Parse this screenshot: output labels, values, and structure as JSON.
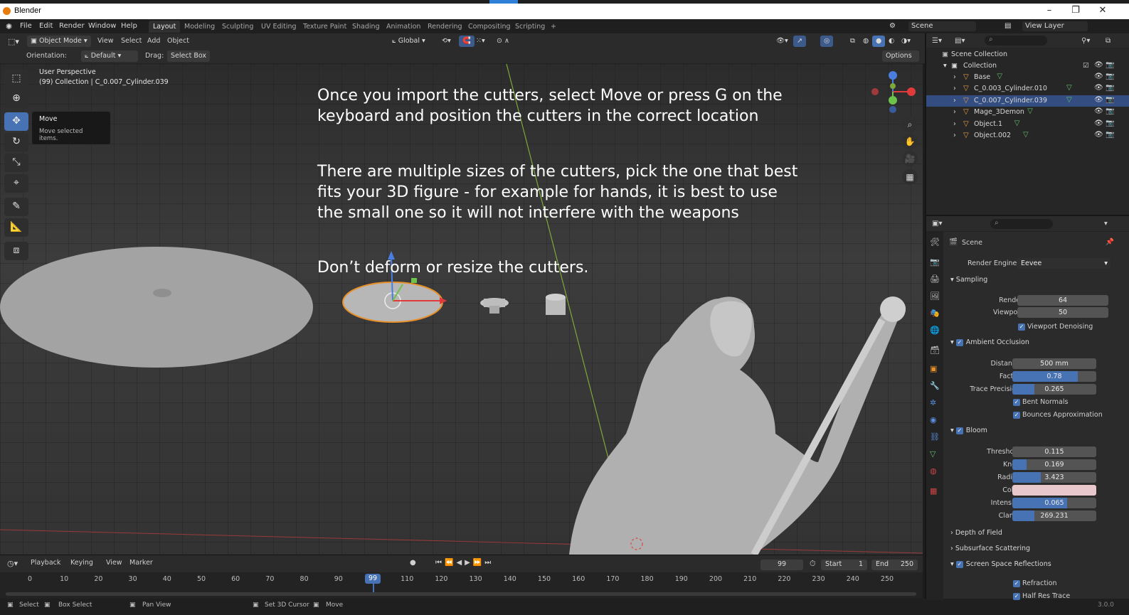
{
  "window": {
    "title": "Blender",
    "controls": [
      "–",
      "❐",
      "✕"
    ]
  },
  "menu": {
    "items": [
      "File",
      "Edit",
      "Render",
      "Window",
      "Help"
    ],
    "workspaces": [
      "Layout",
      "Modeling",
      "Sculpting",
      "UV Editing",
      "Texture Paint",
      "Shading",
      "Animation",
      "Rendering",
      "Compositing",
      "Scripting",
      "+"
    ],
    "scene": "Scene",
    "view_layer": "View Layer"
  },
  "viewport_header": {
    "mode": "Object Mode",
    "menus": [
      "View",
      "Select",
      "Add",
      "Object"
    ],
    "transform_orientation": "Global",
    "orientation_label": "Orientation:",
    "orientation_value": "Default",
    "drag_label": "Drag:",
    "drag_value": "Select Box",
    "options": "Options"
  },
  "viewport": {
    "perspective": "User Perspective",
    "collection_info": "(99) Collection | C_0.007_Cylinder.039",
    "tooltip_title": "Move",
    "tooltip_desc": "Move selected items.",
    "instructions": [
      "Once you import the cutters, select Move or press G on the\nkeyboard and position the cutters in the correct location",
      "There are multiple sizes of the cutters, pick the one that best\nfits your 3D figure - for example for hands, it is best to use\nthe small one so it will not interfere with the weapons",
      "Don’t deform or resize the cutters."
    ]
  },
  "timeline": {
    "menus": [
      "Playback",
      "Keying",
      "View",
      "Marker"
    ],
    "current_frame": "99",
    "start_label": "Start",
    "start": "1",
    "end_label": "End",
    "end": "250",
    "ruler": [
      "0",
      "10",
      "20",
      "30",
      "40",
      "50",
      "60",
      "70",
      "80",
      "90",
      "99",
      "110",
      "120",
      "130",
      "140",
      "150",
      "160",
      "170",
      "180",
      "190",
      "200",
      "210",
      "220",
      "230",
      "240",
      "250"
    ]
  },
  "statusbar": {
    "items": [
      "Select",
      "Box Select",
      "Pan View",
      "Set 3D Cursor",
      "Move"
    ],
    "version": "3.0.0"
  },
  "outliner": {
    "root": "Scene Collection",
    "collection": "Collection",
    "objects": [
      {
        "name": "Base",
        "selected": false
      },
      {
        "name": "C_0.003_Cylinder.010",
        "selected": false
      },
      {
        "name": "C_0.007_Cylinder.039",
        "selected": true
      },
      {
        "name": "Mage_3Demon",
        "selected": false
      },
      {
        "name": "Object.1",
        "selected": false
      },
      {
        "name": "Object.002",
        "selected": false
      }
    ]
  },
  "properties": {
    "context": "Scene",
    "render_engine_label": "Render Engine",
    "render_engine": "Eevee",
    "sampling": {
      "title": "Sampling",
      "render_label": "Render",
      "render": "64",
      "viewport_label": "Viewport",
      "viewport": "50",
      "denoise": "Viewport Denoising"
    },
    "ao": {
      "title": "Ambient Occlusion",
      "distance_label": "Distance",
      "distance": "500 mm",
      "factor_label": "Factor",
      "factor": "0.78",
      "trace_label": "Trace Precision",
      "trace": "0.265",
      "bent_normals": "Bent Normals",
      "bounces": "Bounces Approximation"
    },
    "bloom": {
      "title": "Bloom",
      "threshold_label": "Threshold",
      "threshold": "0.115",
      "knee_label": "Knee",
      "knee": "0.169",
      "radius_label": "Radius",
      "radius": "3.423",
      "color_label": "Color",
      "intensity_label": "Intensity",
      "intensity": "0.065",
      "clamp_label": "Clamp",
      "clamp": "269.231"
    },
    "dof": "Depth of Field",
    "sss": "Subsurface Scattering",
    "ssr": {
      "title": "Screen Space Reflections",
      "refraction": "Refraction",
      "half_res": "Half Res Trace"
    }
  },
  "colors": {
    "accent": "#4772b3",
    "selection_outline": "#e8902a",
    "bloom_color": "#e8c8cc"
  }
}
